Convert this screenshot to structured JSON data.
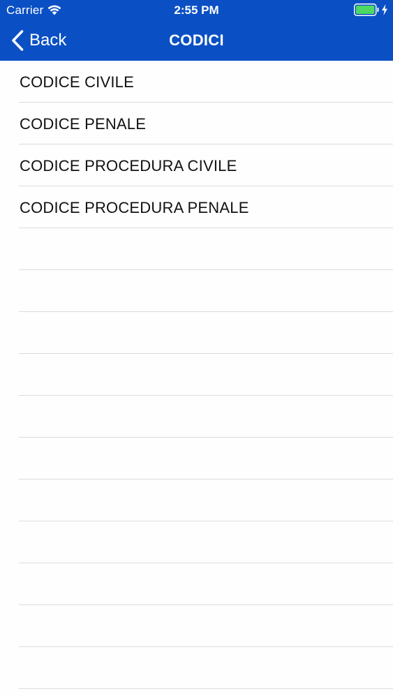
{
  "status_bar": {
    "carrier": "Carrier",
    "time": "2:55 PM",
    "wifi_icon": "wifi-icon",
    "battery_icon": "battery-icon",
    "charging_icon": "bolt-icon",
    "battery_color": "#4cd964"
  },
  "nav": {
    "back_label": "Back",
    "back_icon": "chevron-left-icon",
    "title": "CODICI",
    "bar_color": "#0a50c4"
  },
  "list": {
    "items": [
      {
        "label": "CODICE CIVILE"
      },
      {
        "label": "CODICE PENALE"
      },
      {
        "label": "CODICE PROCEDURA CIVILE"
      },
      {
        "label": "CODICE PROCEDURA PENALE"
      }
    ],
    "empty_rows": 11
  }
}
